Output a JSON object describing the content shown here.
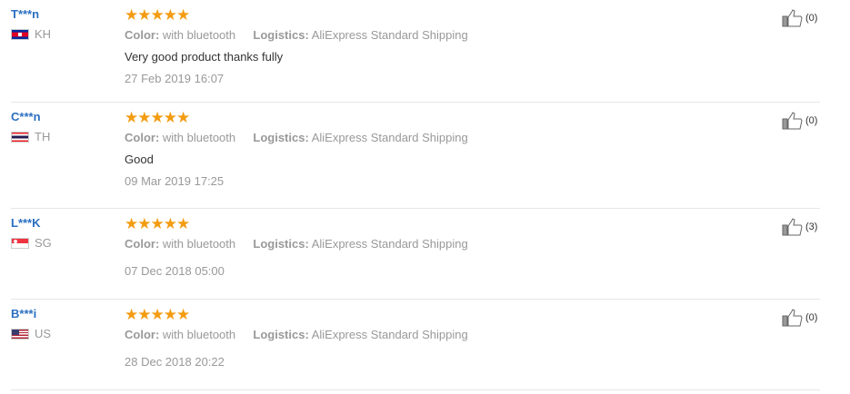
{
  "reviews": [
    {
      "username": "T***n",
      "country": "KH",
      "flag": "kh-flag-icon",
      "stars": "★★★★★",
      "color_label": "Color:",
      "color_value": "with bluetooth",
      "logistics_label": "Logistics:",
      "logistics_value": "AliExpress Standard Shipping",
      "text": "Very good product thanks fully",
      "date": "27 Feb 2019 16:07",
      "likes": "(0)"
    },
    {
      "username": "C***n",
      "country": "TH",
      "flag": "th-flag-icon",
      "stars": "★★★★★",
      "color_label": "Color:",
      "color_value": "with bluetooth",
      "logistics_label": "Logistics:",
      "logistics_value": "AliExpress Standard Shipping",
      "text": "Good",
      "date": "09 Mar 2019 17:25",
      "likes": "(0)"
    },
    {
      "username": "L***K",
      "country": "SG",
      "flag": "sg-flag-icon",
      "stars": "★★★★★",
      "color_label": "Color:",
      "color_value": "with bluetooth",
      "logistics_label": "Logistics:",
      "logistics_value": "AliExpress Standard Shipping",
      "text": "",
      "date": "07 Dec 2018 05:00",
      "likes": "(3)"
    },
    {
      "username": "B***i",
      "country": "US",
      "flag": "us-flag-icon",
      "stars": "★★★★★",
      "color_label": "Color:",
      "color_value": "with bluetooth",
      "logistics_label": "Logistics:",
      "logistics_value": "AliExpress Standard Shipping",
      "text": "",
      "date": "28 Dec 2018 20:22",
      "likes": "(0)"
    }
  ],
  "colors": {
    "username": "#2a6fc0",
    "star": "#f39c12",
    "muted": "#999999",
    "divider": "#e6e6e6"
  }
}
